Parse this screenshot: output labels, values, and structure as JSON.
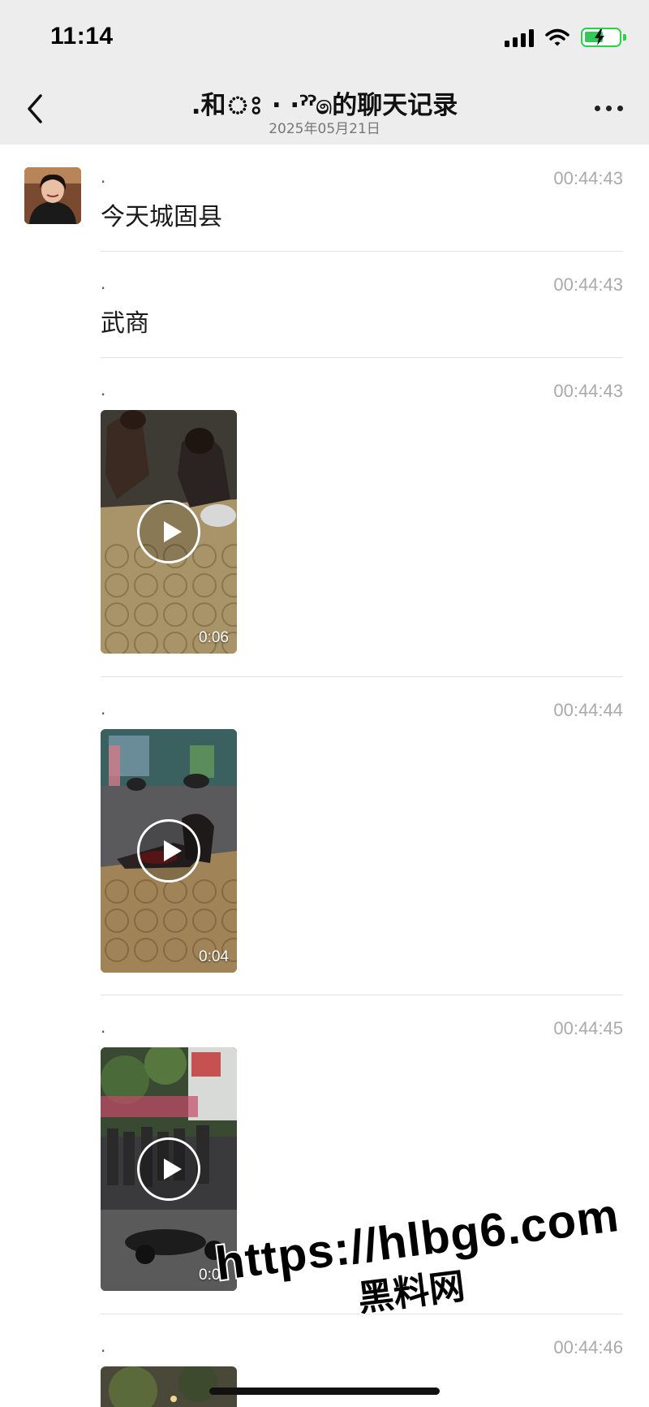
{
  "status_bar": {
    "time": "11:14",
    "icons": [
      "cellular-signal-icon",
      "wifi-icon",
      "battery-charging-icon"
    ]
  },
  "nav": {
    "title": ".和ঃ · ·ˀˀ෧的聊天记录",
    "subtitle": "2025年05月21日",
    "back_icon": "chevron-left-icon",
    "more_icon": "ellipsis-icon"
  },
  "messages": [
    {
      "sender": ".",
      "time": "00:44:43",
      "type": "text",
      "text": "今天城固县"
    },
    {
      "sender": ".",
      "time": "00:44:43",
      "type": "text",
      "text": "武商"
    },
    {
      "sender": ".",
      "time": "00:44:43",
      "type": "video",
      "duration": "0:06"
    },
    {
      "sender": ".",
      "time": "00:44:44",
      "type": "video",
      "duration": "0:04"
    },
    {
      "sender": ".",
      "time": "00:44:45",
      "type": "video",
      "duration": "0:04"
    },
    {
      "sender": ".",
      "time": "00:44:46",
      "type": "video"
    }
  ],
  "watermark": {
    "url": "https://hlbg6.com",
    "text": "黑料网"
  },
  "colors": {
    "header_bg": "#ededed",
    "timestamp": "#aaaaaa",
    "battery": "#34c759"
  }
}
